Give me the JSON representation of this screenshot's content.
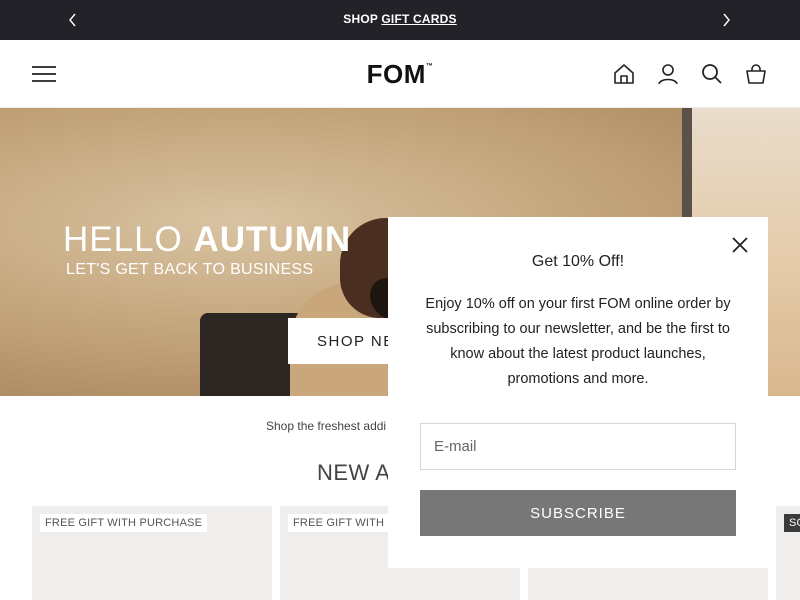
{
  "announcement": {
    "prefix": "SHOP",
    "link": "GIFT CARDS"
  },
  "header": {
    "logo": "FOM",
    "logo_mark": "™"
  },
  "hero": {
    "title_light": "HELLO ",
    "title_bold": "AUTUMN",
    "subtitle": "LET'S GET BACK TO BUSINESS",
    "cta": "SHOP NEW"
  },
  "tagline": "Shop the freshest addi",
  "section_title": "NEW A",
  "products": [
    {
      "badge": "FREE GIFT WITH PURCHASE"
    },
    {
      "badge": "FREE GIFT WITH F"
    },
    {
      "badge": ""
    },
    {
      "badge": "SO"
    }
  ],
  "modal": {
    "title": "Get 10% Off!",
    "body": "Enjoy 10% off on your first FOM online order by subscribing to our newsletter, and be the first to know about the latest product launches, promotions and more.",
    "email_placeholder": "E-mail",
    "subscribe_label": "SUBSCRIBE"
  },
  "colors": {
    "announcement_bg": "#232228",
    "subscribe_bg": "#777777",
    "card_bg": "#efeeec"
  }
}
